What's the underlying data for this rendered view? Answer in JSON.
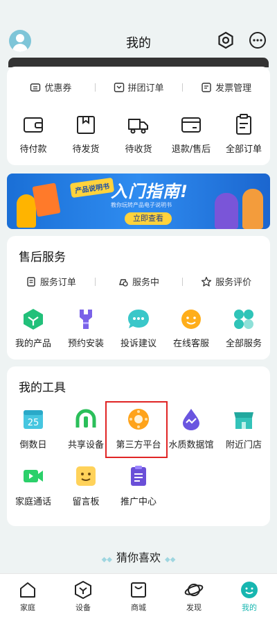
{
  "header": {
    "title": "我的"
  },
  "order_links": [
    "优惠券",
    "拼团订单",
    "发票管理"
  ],
  "orders": [
    {
      "label": "待付款",
      "icon": "wallet-icon"
    },
    {
      "label": "待发货",
      "icon": "package-icon"
    },
    {
      "label": "待收货",
      "icon": "truck-icon"
    },
    {
      "label": "退款/售后",
      "icon": "refund-card-icon"
    },
    {
      "label": "全部订单",
      "icon": "clipboard-list-icon"
    }
  ],
  "banner": {
    "tag": "产品说明书",
    "title": "入门指南!",
    "subtitle": "教你玩转产品电子说明书",
    "cta": "立即查看"
  },
  "service": {
    "title": "售后服务",
    "links": [
      "服务订单",
      "服务中",
      "服务评价"
    ],
    "items": [
      {
        "label": "我的产品",
        "icon": "cube-icon",
        "color": "#22c07a"
      },
      {
        "label": "预约安装",
        "icon": "wrench-icon",
        "color": "#7a62e8"
      },
      {
        "label": "投诉建议",
        "icon": "chat-bubble-icon",
        "color": "#3ac7c9"
      },
      {
        "label": "在线客服",
        "icon": "face-icon",
        "color": "#ffae1a"
      },
      {
        "label": "全部服务",
        "icon": "grid-icon",
        "color": "#2fc4b8"
      }
    ]
  },
  "tools": {
    "title": "我的工具",
    "items": [
      {
        "label": "倒数日",
        "icon": "calendar-icon",
        "day": "25"
      },
      {
        "label": "共享设备",
        "icon": "shared-device-icon"
      },
      {
        "label": "第三方平台",
        "icon": "third-party-platform-icon"
      },
      {
        "label": "水质数据馆",
        "icon": "water-drop-icon"
      },
      {
        "label": "附近门店",
        "icon": "store-icon"
      },
      {
        "label": "家庭通话",
        "icon": "video-call-icon"
      },
      {
        "label": "留言板",
        "icon": "message-board-icon"
      },
      {
        "label": "推广中心",
        "icon": "promotion-icon"
      }
    ]
  },
  "guess": {
    "title": "猜你喜欢"
  },
  "tabbar": [
    {
      "label": "家庭",
      "icon": "home-icon"
    },
    {
      "label": "设备",
      "icon": "device-icon"
    },
    {
      "label": "商城",
      "icon": "shopping-bag-icon"
    },
    {
      "label": "发现",
      "icon": "planet-icon"
    },
    {
      "label": "我的",
      "icon": "smile-icon",
      "active": true
    }
  ],
  "colors": {
    "accent": "#17b6b0",
    "highlight": "#e02424"
  }
}
